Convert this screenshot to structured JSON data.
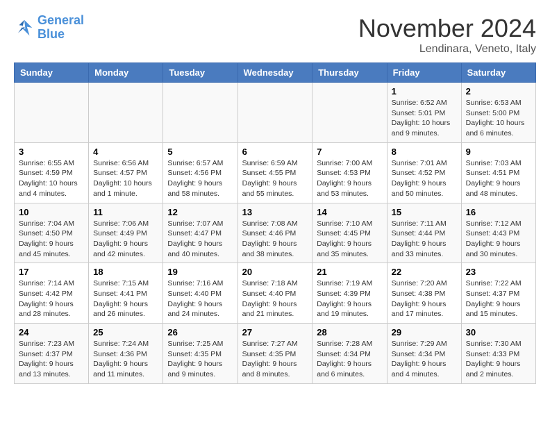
{
  "logo": {
    "line1": "General",
    "line2": "Blue"
  },
  "title": "November 2024",
  "location": "Lendinara, Veneto, Italy",
  "days_of_week": [
    "Sunday",
    "Monday",
    "Tuesday",
    "Wednesday",
    "Thursday",
    "Friday",
    "Saturday"
  ],
  "weeks": [
    [
      {
        "day": "",
        "info": ""
      },
      {
        "day": "",
        "info": ""
      },
      {
        "day": "",
        "info": ""
      },
      {
        "day": "",
        "info": ""
      },
      {
        "day": "",
        "info": ""
      },
      {
        "day": "1",
        "info": "Sunrise: 6:52 AM\nSunset: 5:01 PM\nDaylight: 10 hours and 9 minutes."
      },
      {
        "day": "2",
        "info": "Sunrise: 6:53 AM\nSunset: 5:00 PM\nDaylight: 10 hours and 6 minutes."
      }
    ],
    [
      {
        "day": "3",
        "info": "Sunrise: 6:55 AM\nSunset: 4:59 PM\nDaylight: 10 hours and 4 minutes."
      },
      {
        "day": "4",
        "info": "Sunrise: 6:56 AM\nSunset: 4:57 PM\nDaylight: 10 hours and 1 minute."
      },
      {
        "day": "5",
        "info": "Sunrise: 6:57 AM\nSunset: 4:56 PM\nDaylight: 9 hours and 58 minutes."
      },
      {
        "day": "6",
        "info": "Sunrise: 6:59 AM\nSunset: 4:55 PM\nDaylight: 9 hours and 55 minutes."
      },
      {
        "day": "7",
        "info": "Sunrise: 7:00 AM\nSunset: 4:53 PM\nDaylight: 9 hours and 53 minutes."
      },
      {
        "day": "8",
        "info": "Sunrise: 7:01 AM\nSunset: 4:52 PM\nDaylight: 9 hours and 50 minutes."
      },
      {
        "day": "9",
        "info": "Sunrise: 7:03 AM\nSunset: 4:51 PM\nDaylight: 9 hours and 48 minutes."
      }
    ],
    [
      {
        "day": "10",
        "info": "Sunrise: 7:04 AM\nSunset: 4:50 PM\nDaylight: 9 hours and 45 minutes."
      },
      {
        "day": "11",
        "info": "Sunrise: 7:06 AM\nSunset: 4:49 PM\nDaylight: 9 hours and 42 minutes."
      },
      {
        "day": "12",
        "info": "Sunrise: 7:07 AM\nSunset: 4:47 PM\nDaylight: 9 hours and 40 minutes."
      },
      {
        "day": "13",
        "info": "Sunrise: 7:08 AM\nSunset: 4:46 PM\nDaylight: 9 hours and 38 minutes."
      },
      {
        "day": "14",
        "info": "Sunrise: 7:10 AM\nSunset: 4:45 PM\nDaylight: 9 hours and 35 minutes."
      },
      {
        "day": "15",
        "info": "Sunrise: 7:11 AM\nSunset: 4:44 PM\nDaylight: 9 hours and 33 minutes."
      },
      {
        "day": "16",
        "info": "Sunrise: 7:12 AM\nSunset: 4:43 PM\nDaylight: 9 hours and 30 minutes."
      }
    ],
    [
      {
        "day": "17",
        "info": "Sunrise: 7:14 AM\nSunset: 4:42 PM\nDaylight: 9 hours and 28 minutes."
      },
      {
        "day": "18",
        "info": "Sunrise: 7:15 AM\nSunset: 4:41 PM\nDaylight: 9 hours and 26 minutes."
      },
      {
        "day": "19",
        "info": "Sunrise: 7:16 AM\nSunset: 4:40 PM\nDaylight: 9 hours and 24 minutes."
      },
      {
        "day": "20",
        "info": "Sunrise: 7:18 AM\nSunset: 4:40 PM\nDaylight: 9 hours and 21 minutes."
      },
      {
        "day": "21",
        "info": "Sunrise: 7:19 AM\nSunset: 4:39 PM\nDaylight: 9 hours and 19 minutes."
      },
      {
        "day": "22",
        "info": "Sunrise: 7:20 AM\nSunset: 4:38 PM\nDaylight: 9 hours and 17 minutes."
      },
      {
        "day": "23",
        "info": "Sunrise: 7:22 AM\nSunset: 4:37 PM\nDaylight: 9 hours and 15 minutes."
      }
    ],
    [
      {
        "day": "24",
        "info": "Sunrise: 7:23 AM\nSunset: 4:37 PM\nDaylight: 9 hours and 13 minutes."
      },
      {
        "day": "25",
        "info": "Sunrise: 7:24 AM\nSunset: 4:36 PM\nDaylight: 9 hours and 11 minutes."
      },
      {
        "day": "26",
        "info": "Sunrise: 7:25 AM\nSunset: 4:35 PM\nDaylight: 9 hours and 9 minutes."
      },
      {
        "day": "27",
        "info": "Sunrise: 7:27 AM\nSunset: 4:35 PM\nDaylight: 9 hours and 8 minutes."
      },
      {
        "day": "28",
        "info": "Sunrise: 7:28 AM\nSunset: 4:34 PM\nDaylight: 9 hours and 6 minutes."
      },
      {
        "day": "29",
        "info": "Sunrise: 7:29 AM\nSunset: 4:34 PM\nDaylight: 9 hours and 4 minutes."
      },
      {
        "day": "30",
        "info": "Sunrise: 7:30 AM\nSunset: 4:33 PM\nDaylight: 9 hours and 2 minutes."
      }
    ]
  ]
}
